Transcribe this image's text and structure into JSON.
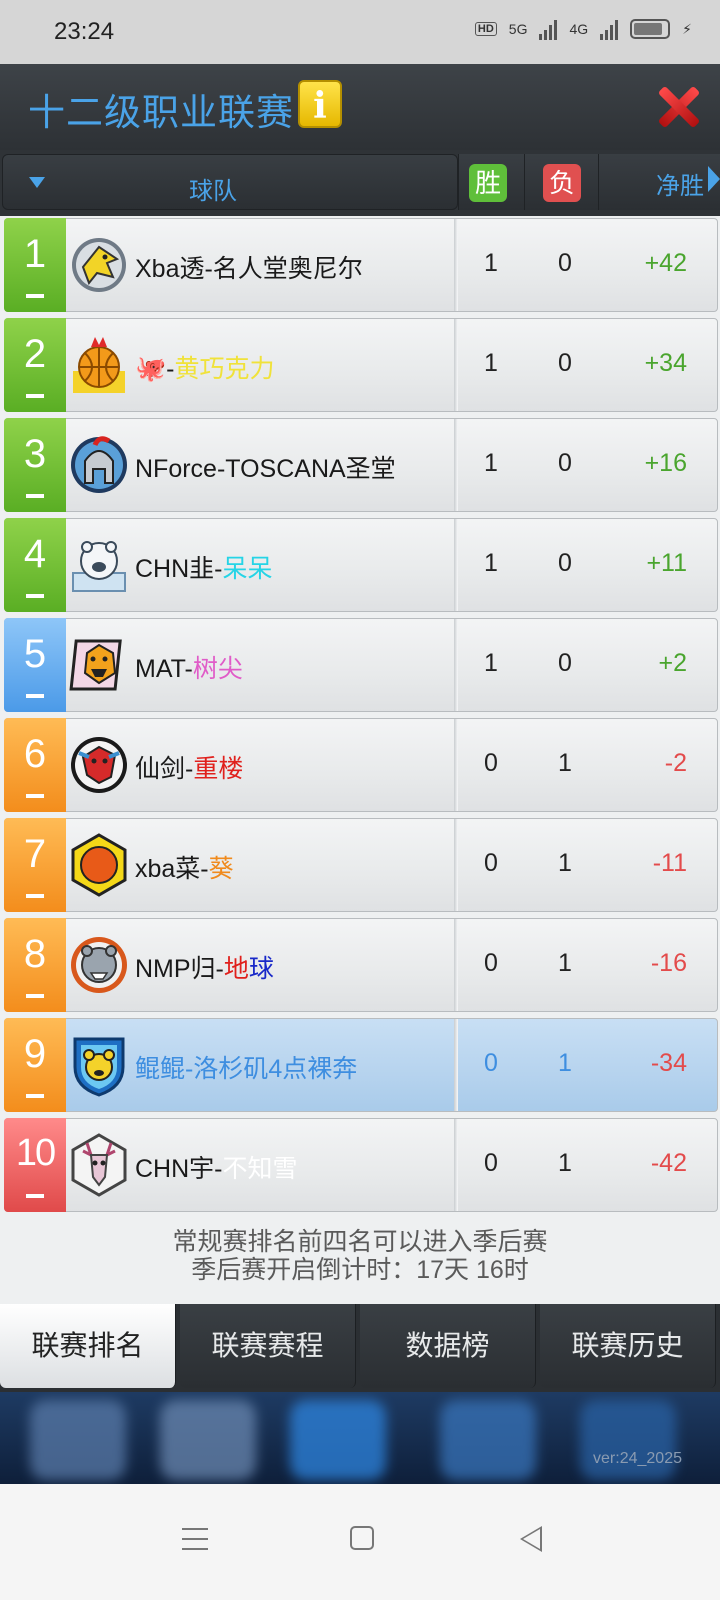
{
  "status_bar": {
    "time": "23:24",
    "net1": "5G",
    "net2": "4G"
  },
  "header": {
    "title": "十二级职业联赛",
    "info_icon": "info-icon",
    "close_icon": "close-icon"
  },
  "table_header": {
    "team": "球队",
    "win": "胜",
    "loss": "负",
    "net": "净胜"
  },
  "standings": [
    {
      "rank": "1",
      "team_prefix": "Xba透-名人堂奥尼尔",
      "team_suffix": "",
      "suffix_color": "#1a1a1a",
      "wins": "1",
      "losses": "0",
      "net": "+42",
      "rank_color": "green",
      "logo": "yellow-eagle-logo"
    },
    {
      "rank": "2",
      "team_prefix": "🐙-",
      "team_suffix": "黄巧克力",
      "suffix_color": "#f0e23a",
      "wins": "1",
      "losses": "0",
      "net": "+34",
      "rank_color": "green",
      "logo": "basketball-crown-logo"
    },
    {
      "rank": "3",
      "team_prefix": "NForce-TOSCANA圣堂",
      "team_suffix": "",
      "suffix_color": "#1a1a1a",
      "wins": "1",
      "losses": "0",
      "net": "+16",
      "rank_color": "green",
      "logo": "spartan-helmet-logo"
    },
    {
      "rank": "4",
      "team_prefix": "CHN韭-",
      "team_suffix": "呆呆",
      "suffix_color": "#25d4e6",
      "wins": "1",
      "losses": "0",
      "net": "+11",
      "rank_color": "green",
      "logo": "polar-bear-logo"
    },
    {
      "rank": "5",
      "team_prefix": "MAT-",
      "team_suffix": "树尖",
      "suffix_color": "#e05cc8",
      "wins": "1",
      "losses": "0",
      "net": "+2",
      "rank_color": "blue",
      "logo": "orange-beast-logo"
    },
    {
      "rank": "6",
      "team_prefix": "仙剑-",
      "team_suffix": "重楼",
      "suffix_color": "#e0201c",
      "wins": "0",
      "losses": "1",
      "net": "-2",
      "rank_color": "orange",
      "logo": "red-dragon-logo"
    },
    {
      "rank": "7",
      "team_prefix": "xba菜-",
      "team_suffix": "葵",
      "suffix_color": "#f08a1c",
      "wins": "0",
      "losses": "1",
      "net": "-11",
      "rank_color": "orange",
      "logo": "orange-hexagon-logo"
    },
    {
      "rank": "8",
      "team_prefix": "NMP归-",
      "team_suffix_a": "地",
      "team_suffix_b": "球",
      "suffix_color_a": "#e0201c",
      "suffix_color_b": "#1828c8",
      "wins": "0",
      "losses": "1",
      "net": "-16",
      "rank_color": "orange",
      "logo": "grizzly-bear-logo"
    },
    {
      "rank": "9",
      "team_prefix": "鲲鲲-洛杉矶4点裸奔",
      "team_suffix": "",
      "suffix_color": "#3e8ee0",
      "wins": "0",
      "losses": "1",
      "net": "-34",
      "rank_color": "orange",
      "logo": "yellow-bear-shield-logo",
      "highlight": true
    },
    {
      "rank": "10",
      "team_prefix": "CHN宇-",
      "team_suffix": "不知雪",
      "suffix_color": "#ffffff",
      "wins": "0",
      "losses": "1",
      "net": "-42",
      "rank_color": "red",
      "logo": "deer-skull-logo"
    }
  ],
  "note": {
    "line1": "常规赛排名前四名可以进入季后赛",
    "line2": "季后赛开启倒计时：17天 16时"
  },
  "tabs": [
    {
      "label": "联赛排名",
      "active": true
    },
    {
      "label": "联赛赛程",
      "active": false
    },
    {
      "label": "数据榜",
      "active": false
    },
    {
      "label": "联赛历史",
      "active": false
    }
  ],
  "version": "ver:24_2025",
  "colors": {
    "accent": "#4aa3e8",
    "positive": "#4aa52e",
    "negative": "#e34b4b",
    "rank_green": "#5aae24",
    "rank_blue": "#4b9ae8",
    "rank_orange": "#f38d1c",
    "rank_red": "#e04a4a"
  }
}
